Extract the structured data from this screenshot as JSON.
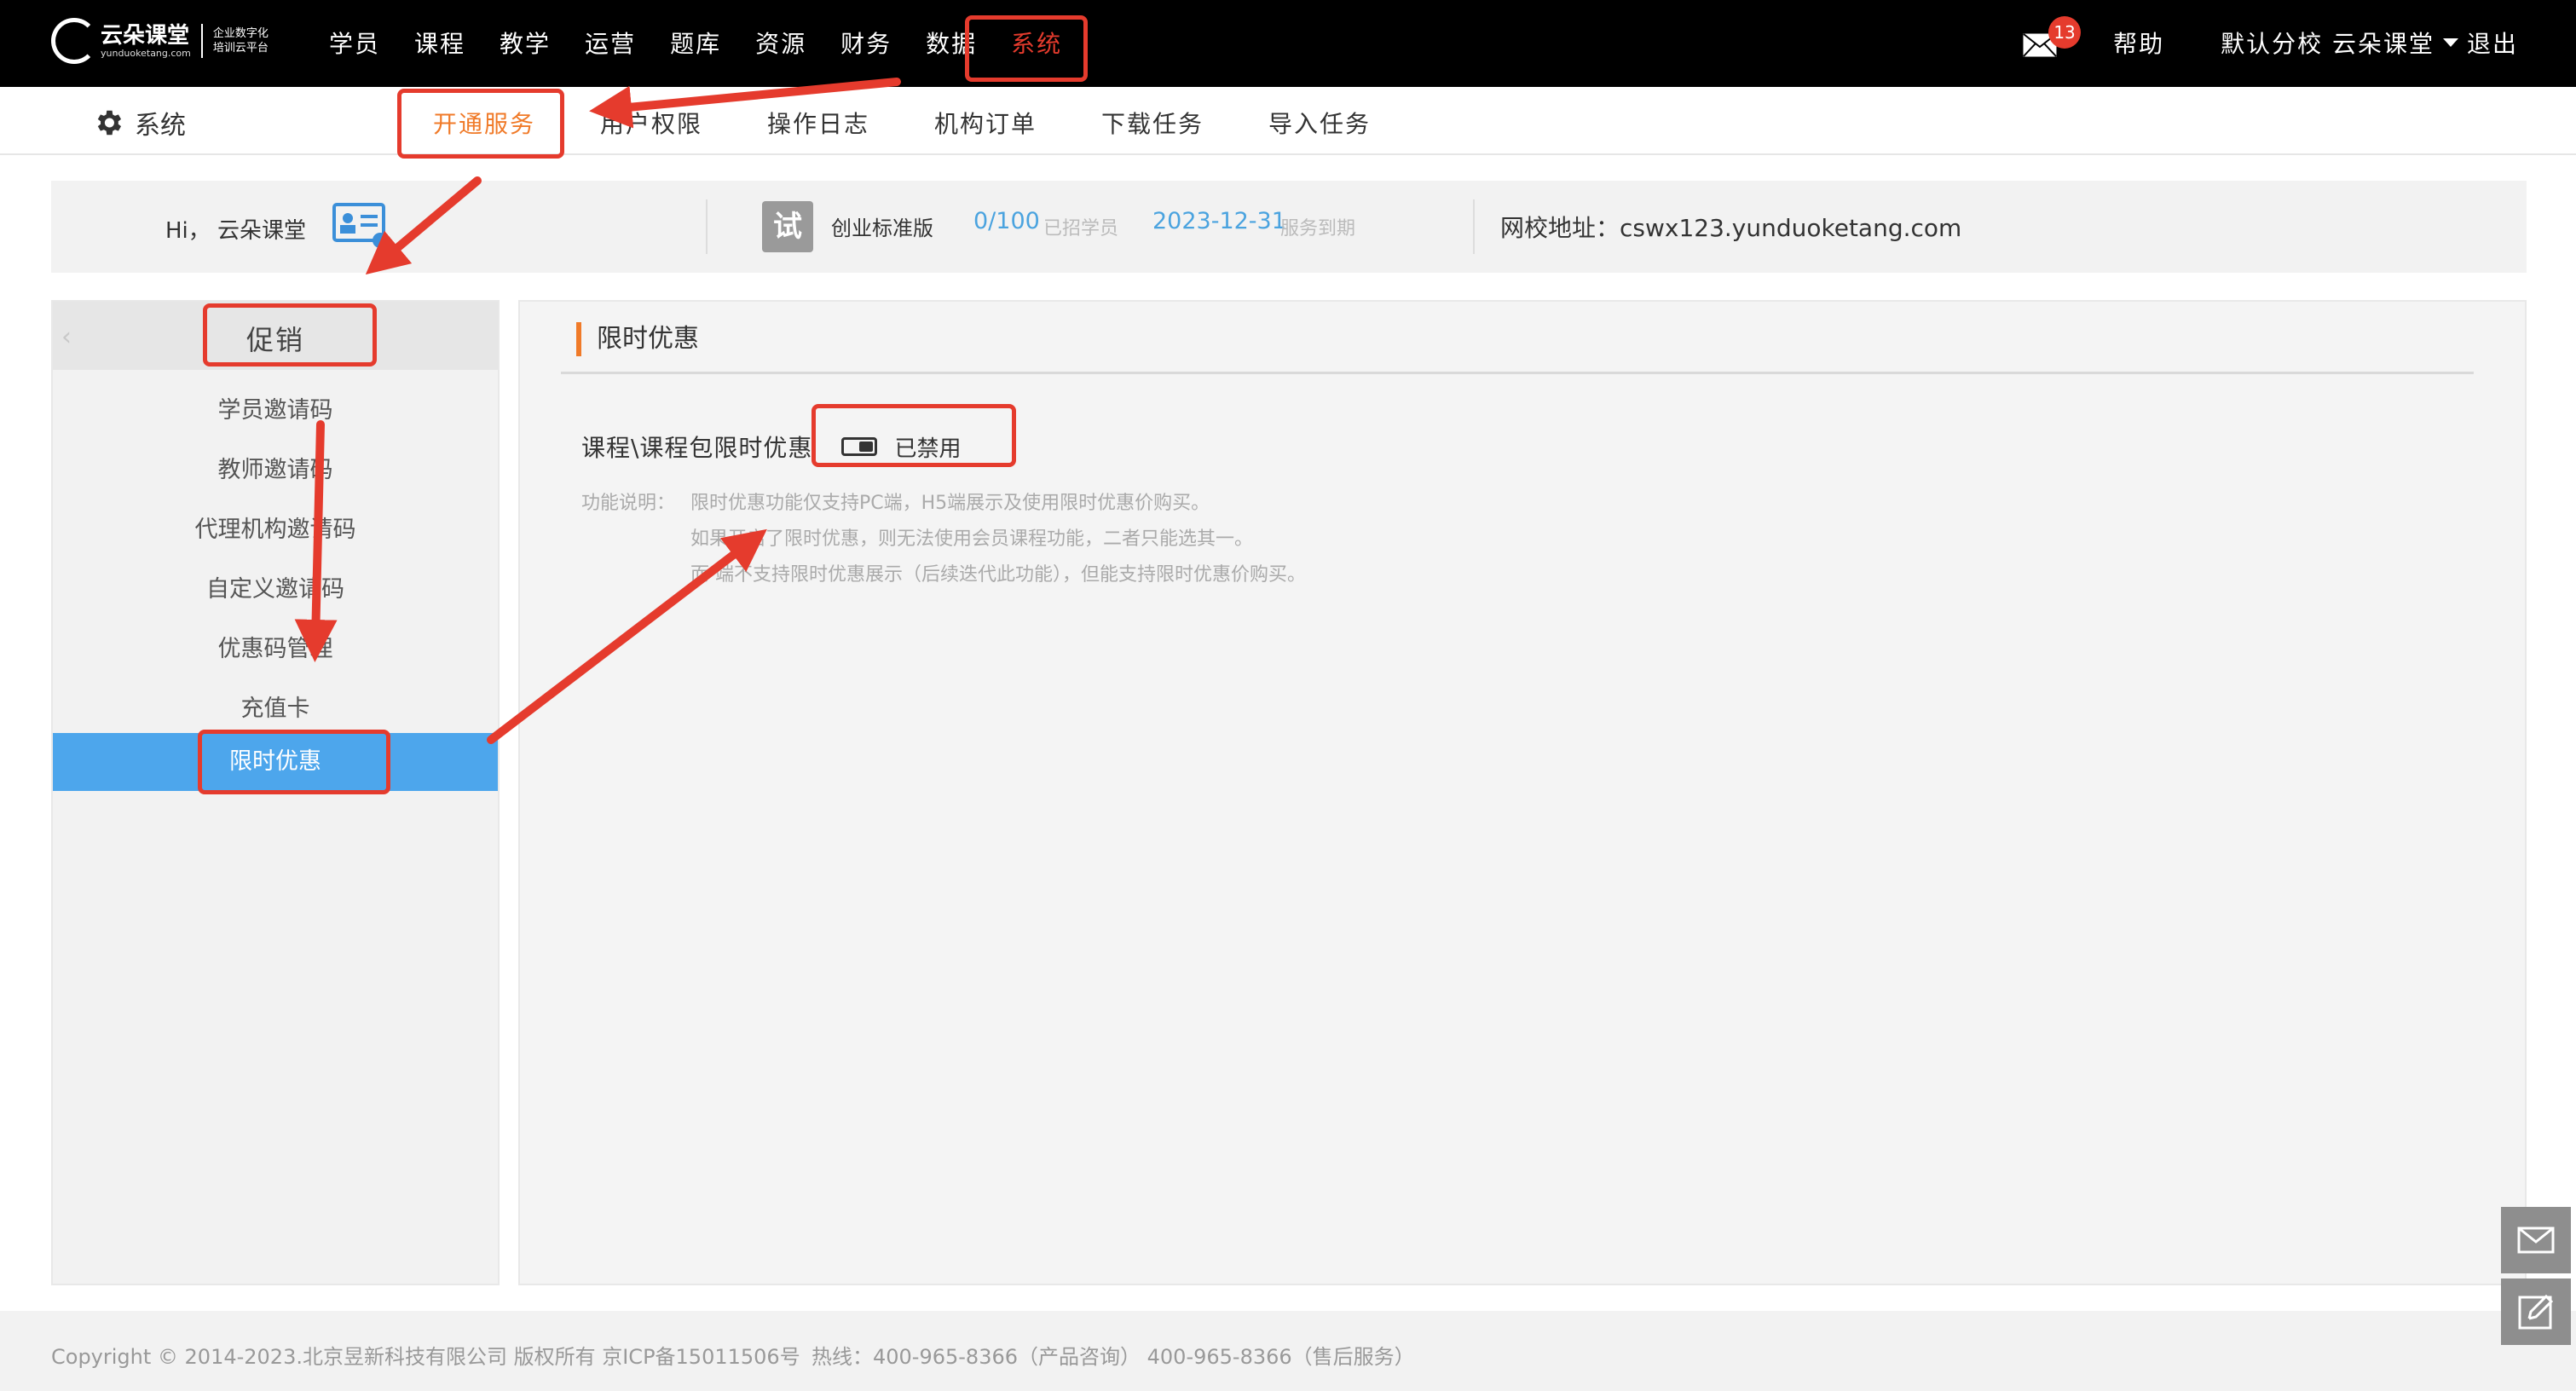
{
  "logo": {
    "brand": "云朵课堂",
    "domain": "yunduoketang.com",
    "tagline_line1": "企业数字化",
    "tagline_line2": "培训云平台"
  },
  "top_nav": [
    "学员",
    "课程",
    "教学",
    "运营",
    "题库",
    "资源",
    "财务",
    "数据",
    "系统"
  ],
  "top_right": {
    "mail_count": "13",
    "help": "帮助",
    "school": "默认分校 云朵课堂",
    "logout": "退出"
  },
  "sub_header": {
    "title": "系统",
    "tabs": [
      "开通服务",
      "用户权限",
      "操作日志",
      "机构订单",
      "下载任务",
      "导入任务"
    ]
  },
  "info_bar": {
    "greeting": "Hi，  云朵课堂",
    "trial_badge": "试",
    "plan": "创业标准版",
    "student_count": "0/100",
    "student_label": "已招学员",
    "expire_date": "2023-12-31",
    "expire_label": "服务到期",
    "school_url": "网校地址：cswx123.yunduoketang.com"
  },
  "sidebar": {
    "header": "促销",
    "items": [
      "学员邀请码",
      "教师邀请码",
      "代理机构邀请码",
      "自定义邀请码",
      "优惠码管理",
      "充值卡",
      "限时优惠"
    ]
  },
  "main": {
    "title": "限时优惠",
    "setting_label": "课程\\课程包限时优惠",
    "toggle_state": "已禁用",
    "desc_label": "功能说明：",
    "desc_lines": [
      "限时优惠功能仅支持PC端，H5端展示及使用限时优惠价购买。",
      "如果开启了限时优惠，则无法使用会员课程功能，二者只能选其一。",
      "而      端不支持限时优惠展示（后续迭代此功能），但能支持限时优惠价购买。"
    ]
  },
  "footer": {
    "copyright": "Copyright © 2014-2023.北京昱新科技有限公司 版权所有 京ICP备15011506号",
    "hotline": "热线：400-965-8366（产品咨询） 400-965-8366（售后服务）"
  },
  "colors": {
    "topbar": "#000000",
    "accent_orange": "#f07a28",
    "annotation_red": "#e53b2d",
    "active_blue": "#4da6ec",
    "link_blue": "#4aa3df"
  },
  "icons": [
    "mail-icon",
    "gear-icon",
    "id-card-icon",
    "chevron-left-icon",
    "toggle-icon",
    "message-icon",
    "edit-icon"
  ]
}
